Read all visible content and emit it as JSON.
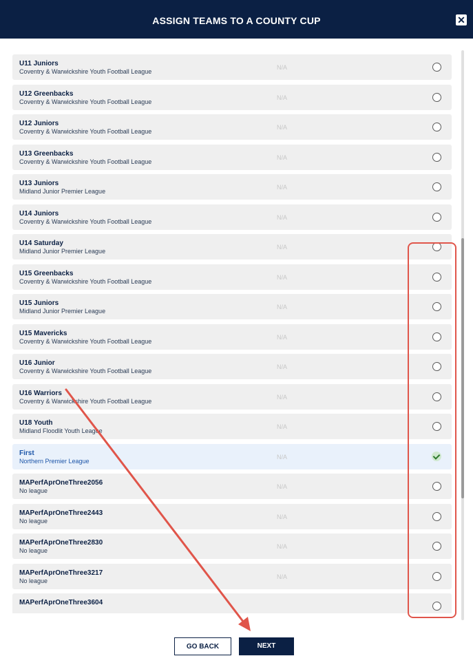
{
  "header": {
    "title": "ASSIGN TEAMS TO A COUNTY CUP",
    "close_label": "✕"
  },
  "teams": [
    {
      "name": "U11 Juniors",
      "league": "Coventry & Warwickshire Youth Football League",
      "status": "N/A",
      "selected": false
    },
    {
      "name": "U12 Greenbacks",
      "league": "Coventry & Warwickshire Youth Football League",
      "status": "N/A",
      "selected": false
    },
    {
      "name": "U12 Juniors",
      "league": "Coventry & Warwickshire Youth Football League",
      "status": "N/A",
      "selected": false
    },
    {
      "name": "U13 Greenbacks",
      "league": "Coventry & Warwickshire Youth Football League",
      "status": "N/A",
      "selected": false
    },
    {
      "name": "U13 Juniors",
      "league": "Midland Junior Premier League",
      "status": "N/A",
      "selected": false
    },
    {
      "name": "U14 Juniors",
      "league": "Coventry & Warwickshire Youth Football League",
      "status": "N/A",
      "selected": false
    },
    {
      "name": "U14 Saturday",
      "league": "Midland Junior Premier League",
      "status": "N/A",
      "selected": false
    },
    {
      "name": "U15 Greenbacks",
      "league": "Coventry & Warwickshire Youth Football League",
      "status": "N/A",
      "selected": false
    },
    {
      "name": "U15 Juniors",
      "league": "Midland Junior Premier League",
      "status": "N/A",
      "selected": false
    },
    {
      "name": "U15 Mavericks",
      "league": "Coventry & Warwickshire Youth Football League",
      "status": "N/A",
      "selected": false
    },
    {
      "name": "U16 Junior",
      "league": "Coventry & Warwickshire Youth Football League",
      "status": "N/A",
      "selected": false
    },
    {
      "name": "U16 Warriors",
      "league": "Coventry & Warwickshire Youth Football League",
      "status": "N/A",
      "selected": false
    },
    {
      "name": "U18 Youth",
      "league": "Midland Floodlit Youth League",
      "status": "N/A",
      "selected": false
    },
    {
      "name": "First",
      "league": "Northern Premier League",
      "status": "N/A",
      "selected": true
    },
    {
      "name": "MAPerfAprOneThree2056",
      "league": "No league",
      "status": "N/A",
      "selected": false
    },
    {
      "name": "MAPerfAprOneThree2443",
      "league": "No league",
      "status": "N/A",
      "selected": false
    },
    {
      "name": "MAPerfAprOneThree2830",
      "league": "No league",
      "status": "N/A",
      "selected": false
    },
    {
      "name": "MAPerfAprOneThree3217",
      "league": "No league",
      "status": "N/A",
      "selected": false
    },
    {
      "name": "MAPerfAprOneThree3604",
      "league": "",
      "status": "",
      "selected": false
    }
  ],
  "footer": {
    "back_label": "GO BACK",
    "next_label": "NEXT"
  },
  "colors": {
    "navy": "#0b2044",
    "annotation": "#e0554a",
    "selected_row": "#e9f1fb",
    "check_green": "#2d7a2d"
  }
}
